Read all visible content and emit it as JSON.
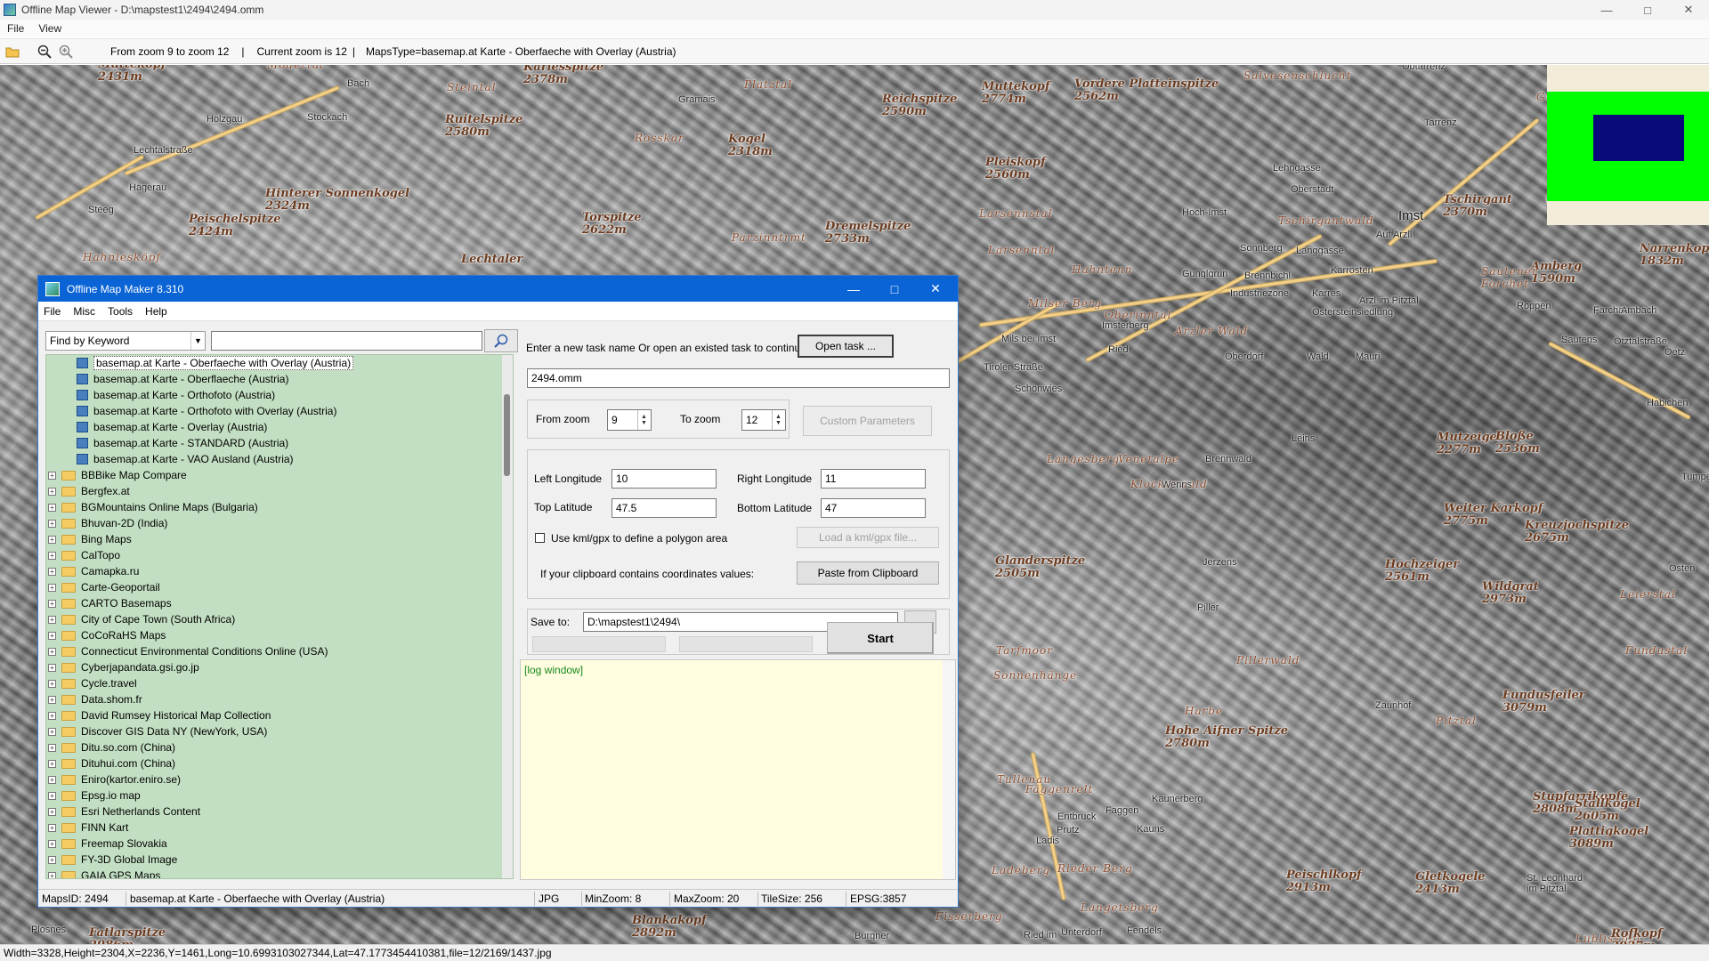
{
  "window": {
    "title": "Offline Map Viewer - D:\\mapstest1\\2494\\2494.omm",
    "menu": [
      "File",
      "View"
    ],
    "controls": {
      "minimize": "—",
      "maximize": "□",
      "close": "✕"
    }
  },
  "toolbar": {
    "zoom_range": "From zoom 9 to zoom 12",
    "current_zoom": "Current zoom is 12",
    "maps_type": "MapsType=basemap.at Karte - Oberfaeche with Overlay (Austria)",
    "sep": "|"
  },
  "map_labels": [
    {
      "text": "2651m",
      "cls": "peak"
    },
    {
      "text": "Muttekopf\n2431m",
      "cls": "peak"
    },
    {
      "text": "Modertal",
      "cls": "region"
    },
    {
      "text": "Bach",
      "cls": "town"
    },
    {
      "text": "Steintal",
      "cls": "region"
    },
    {
      "text": "Karlesspitze\n2378m",
      "cls": "peak"
    },
    {
      "text": "Gramais",
      "cls": "town"
    },
    {
      "text": "Platztal",
      "cls": "region"
    },
    {
      "text": "Reichspitze\n2590m",
      "cls": "peak"
    },
    {
      "text": "Muttekopf\n2774m",
      "cls": "peak"
    },
    {
      "text": "Vordere Platteinspitze\n2562m",
      "cls": "peak"
    },
    {
      "text": "Salvesenschlucht",
      "cls": "region"
    },
    {
      "text": "Obtarrenz",
      "cls": "town"
    },
    {
      "text": "Holzgau",
      "cls": "town"
    },
    {
      "text": "Stockach",
      "cls": "town"
    },
    {
      "text": "Ruitelspitze\n2580m",
      "cls": "peak"
    },
    {
      "text": "Rosskar",
      "cls": "region"
    },
    {
      "text": "Kogel\n2318m",
      "cls": "peak"
    },
    {
      "text": "Pleiskopf\n2560m",
      "cls": "peak"
    },
    {
      "text": "Tarrenz",
      "cls": "town"
    },
    {
      "text": "Gurgltal",
      "cls": "region"
    },
    {
      "text": "Lechtalstraße",
      "cls": "town"
    },
    {
      "text": "Hägerau",
      "cls": "town"
    },
    {
      "text": "Hinterer Sonnenkogel\n2324m",
      "cls": "peak"
    },
    {
      "text": "Lehngasse",
      "cls": "town"
    },
    {
      "text": "Oberstadt",
      "cls": "town"
    },
    {
      "text": "Imst",
      "cls": "big"
    },
    {
      "text": "Tschirgant\n2370m",
      "cls": "peak"
    },
    {
      "text": "Weißwand",
      "cls": "region"
    },
    {
      "text": "Steeg",
      "cls": "town"
    },
    {
      "text": "Peischelspitze\n2424m",
      "cls": "peak"
    },
    {
      "text": "Torspitze\n2622m",
      "cls": "peak"
    },
    {
      "text": "Parzinntrmt",
      "cls": "region"
    },
    {
      "text": "Dremelspitze\n2733m",
      "cls": "peak"
    },
    {
      "text": "Larsennstal",
      "cls": "region"
    },
    {
      "text": "Hoch-Imst",
      "cls": "town"
    },
    {
      "text": "Tschirgantwald",
      "cls": "region"
    },
    {
      "text": "Auf Arzll",
      "cls": "town"
    },
    {
      "text": "Hahnlesköpf",
      "cls": "region"
    },
    {
      "text": "Lechtaler",
      "cls": "peak"
    },
    {
      "text": "Larsenntal",
      "cls": "region"
    },
    {
      "text": "Sonnberg",
      "cls": "town"
    },
    {
      "text": "Langgasse",
      "cls": "town"
    },
    {
      "text": "Hahntenn",
      "cls": "region"
    },
    {
      "text": "Gunglgrün",
      "cls": "town"
    },
    {
      "text": "Brennbichl",
      "cls": "town"
    },
    {
      "text": "Karrösten",
      "cls": "town"
    },
    {
      "text": "Amberg\n1590m",
      "cls": "peak"
    },
    {
      "text": "Narrenkopf\n1832m",
      "cls": "peak"
    },
    {
      "text": "Industriezone",
      "cls": "town"
    },
    {
      "text": "Karres",
      "cls": "town"
    },
    {
      "text": "Milser Berg",
      "cls": "region"
    },
    {
      "text": "Ostersteinsiedlung",
      "cls": "town"
    },
    {
      "text": "Sautener\nForchet",
      "cls": "region"
    },
    {
      "text": "Oberinntal",
      "cls": "region"
    },
    {
      "text": "Arzl im Pitztal",
      "cls": "town"
    },
    {
      "text": "Roppen",
      "cls": "town"
    },
    {
      "text": "Farchat",
      "cls": "town"
    },
    {
      "text": "Ambach",
      "cls": "town"
    },
    {
      "text": "Mils bei Imst",
      "cls": "town"
    },
    {
      "text": "Imsterberg",
      "cls": "town"
    },
    {
      "text": "Arzler Wald",
      "cls": "region"
    },
    {
      "text": "Sautens",
      "cls": "town"
    },
    {
      "text": "Ötztalstraße",
      "cls": "town"
    },
    {
      "text": "Oetz",
      "cls": "town"
    },
    {
      "text": "Ried",
      "cls": "town"
    },
    {
      "text": "Oberdorf",
      "cls": "town"
    },
    {
      "text": "Wald",
      "cls": "town"
    },
    {
      "text": "Mauri",
      "cls": "town"
    },
    {
      "text": "Schönwies",
      "cls": "town"
    },
    {
      "text": "Tiroler Straße",
      "cls": "town"
    },
    {
      "text": "Habichen",
      "cls": "town"
    },
    {
      "text": "Langesberg",
      "cls": "region"
    },
    {
      "text": "Venetalpe",
      "cls": "region"
    },
    {
      "text": "Brennwald",
      "cls": "town"
    },
    {
      "text": "Leins",
      "cls": "town"
    },
    {
      "text": "Mutzeiger\n2277m",
      "cls": "peak"
    },
    {
      "text": "Bloße\n2536m",
      "cls": "peak"
    },
    {
      "text": "Tumpen",
      "cls": "town"
    },
    {
      "text": "Klockerwald",
      "cls": "region"
    },
    {
      "text": "Wenns",
      "cls": "town"
    },
    {
      "text": "Weiter Karkopf\n2775m",
      "cls": "peak"
    },
    {
      "text": "Kreuzjochspitze\n2675m",
      "cls": "peak"
    },
    {
      "text": "Glanderspitze\n2505m",
      "cls": "peak"
    },
    {
      "text": "Jerzens",
      "cls": "town"
    },
    {
      "text": "Hochzeiger\n2561m",
      "cls": "peak"
    },
    {
      "text": "Wildgrat\n2973m",
      "cls": "peak"
    },
    {
      "text": "Leierstal",
      "cls": "region"
    },
    {
      "text": "Östen",
      "cls": "town"
    },
    {
      "text": "Tarfmoor",
      "cls": "region"
    },
    {
      "text": "Piller",
      "cls": "town"
    },
    {
      "text": "Pillerwald",
      "cls": "region"
    },
    {
      "text": "Fundustal",
      "cls": "region"
    },
    {
      "text": "Sonnenhänge",
      "cls": "region"
    },
    {
      "text": "Harbe",
      "cls": "region"
    },
    {
      "text": "Zaunhof",
      "cls": "town"
    },
    {
      "text": "Fundusfeiler\n3079m",
      "cls": "peak"
    },
    {
      "text": "Hohe Aifner Spitze\n2780m",
      "cls": "peak"
    },
    {
      "text": "Pitztal",
      "cls": "region"
    },
    {
      "text": "Tullenau",
      "cls": "region"
    },
    {
      "text": "Stupfarrikopfe\n2808m",
      "cls": "peak"
    },
    {
      "text": "Stallkogel\n2605m",
      "cls": "peak"
    },
    {
      "text": "Fäggenrelt",
      "cls": "region"
    },
    {
      "text": "Kaunerberg",
      "cls": "town"
    },
    {
      "text": "Faggen",
      "cls": "town"
    },
    {
      "text": "Entbruck",
      "cls": "town"
    },
    {
      "text": "Kauns",
      "cls": "town"
    },
    {
      "text": "Plattigkogel\n3089m",
      "cls": "peak"
    },
    {
      "text": "Ladis",
      "cls": "town"
    },
    {
      "text": "Prutz",
      "cls": "town"
    },
    {
      "text": "Ladeberg",
      "cls": "region"
    },
    {
      "text": "Rieder Berg",
      "cls": "region"
    },
    {
      "text": "Peischlkopf\n2913m",
      "cls": "peak"
    },
    {
      "text": "Gletkogele\n2413m",
      "cls": "peak"
    },
    {
      "text": "St. Leonhard\nim Pitztal",
      "cls": "town"
    },
    {
      "text": "Langetsberg",
      "cls": "region"
    },
    {
      "text": "Blankakopf\n2892m",
      "cls": "peak"
    },
    {
      "text": "Unterdorf",
      "cls": "town"
    },
    {
      "text": "Fendels",
      "cls": "town"
    },
    {
      "text": "Ried im",
      "cls": "town"
    },
    {
      "text": "Fisserberg",
      "cls": "region"
    },
    {
      "text": "Burgner",
      "cls": "town"
    },
    {
      "text": "Fatlarspitze\n2986m",
      "cls": "peak"
    },
    {
      "text": "Plosnes",
      "cls": "town"
    },
    {
      "text": "Lublisköpf",
      "cls": "region"
    },
    {
      "text": "Rofkopf\n2927m",
      "cls": "peak"
    }
  ],
  "status_bar": "Width=3328,Height=2304,X=2236,Y=1461,Long=10.6993103027344,Lat=47.1773454410381,file=12/2169/1437.jpg",
  "dialog": {
    "title": "Offline Map Maker 8.310",
    "menu": [
      "File",
      "Misc",
      "Tools",
      "Help"
    ],
    "find_mode": "Find by Keyword",
    "search_value": "",
    "tree_leaves": [
      "basemap.at Karte - Oberfaeche with Overlay (Austria)",
      "basemap.at Karte - Oberflaeche (Austria)",
      "basemap.at Karte - Orthofoto (Austria)",
      "basemap.at Karte - Orthofoto with Overlay (Austria)",
      "basemap.at Karte - Overlay (Austria)",
      "basemap.at Karte - STANDARD (Austria)",
      "basemap.at Karte - VAO Ausland (Austria)"
    ],
    "tree_nodes": [
      "BBBike Map Compare",
      "Bergfex.at",
      "BGMountains Online Maps (Bulgaria)",
      "Bhuvan-2D (India)",
      "Bing Maps",
      "CalTopo",
      "Camapka.ru",
      "Carte-Geoportail",
      "CARTO Basemaps",
      "City of Cape Town (South Africa)",
      "CoCoRaHS Maps",
      "Connecticut Environmental Conditions Online (USA)",
      "Cyberjapandata.gsi.go.jp",
      "Cycle.travel",
      "Data.shom.fr",
      "David Rumsey Historical Map Collection",
      "Discover GIS Data NY (NewYork, USA)",
      "Ditu.so.com (China)",
      "Dituhui.com (China)",
      "Eniro(kartor.eniro.se)",
      "Epsg.io map",
      "Esri Netherlands Content",
      "FINN Kart",
      "Freemap Slovakia",
      "FY-3D Global Image",
      "GAIA GPS Maps"
    ],
    "task_prompt": "Enter a new task name Or open an existed task to continue:",
    "open_task": "Open task ...",
    "task_name": "2494.omm",
    "from_zoom_label": "From zoom",
    "from_zoom": "9",
    "to_zoom_label": "To zoom",
    "to_zoom": "12",
    "custom_params": "Custom Parameters",
    "left_lon_label": "Left Longitude",
    "left_lon": "10",
    "right_lon_label": "Right Longitude",
    "right_lon": "11",
    "top_lat_label": "Top Latitude",
    "top_lat": "47.5",
    "bottom_lat_label": "Bottom Latitude",
    "bottom_lat": "47",
    "kml_label": "Use kml/gpx to define a polygon area",
    "load_kml": "Load a kml/gpx file...",
    "clipboard_prompt": "If your clipboard contains coordinates values:",
    "paste_clipboard": "Paste from Clipboard",
    "save_to_label": "Save to:",
    "save_to": "D:\\mapstest1\\2494\\",
    "browse": "...",
    "start": "Start",
    "log": "[log window]",
    "status": {
      "maps_id": "MapsID: 2494",
      "map_name": "basemap.at Karte - Oberfaeche with Overlay (Austria)",
      "format": "JPG",
      "min_zoom": "MinZoom: 8",
      "max_zoom": "MaxZoom: 20",
      "tile_size": "TileSize: 256",
      "epsg": "EPSG:3857"
    },
    "controls": {
      "minimize": "—",
      "maximize": "□",
      "close": "✕"
    }
  }
}
